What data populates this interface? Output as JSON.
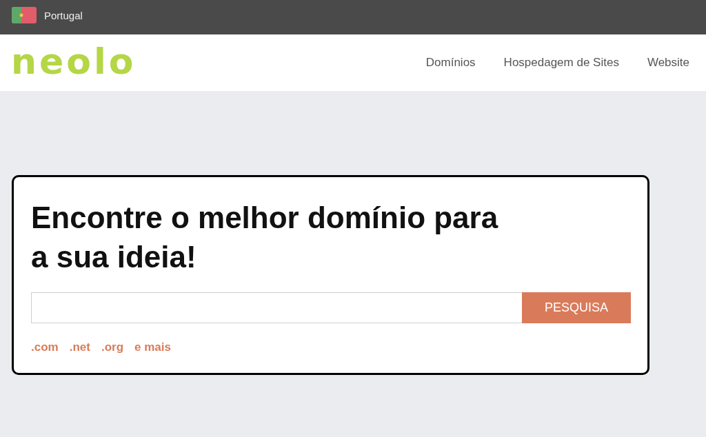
{
  "top_bar": {
    "country": "Portugal"
  },
  "header": {
    "logo": "neolo",
    "nav": [
      "Domínios",
      "Hospedagem de Sites",
      "Website"
    ]
  },
  "search_card": {
    "heading": "Encontre o melhor domínio para a sua ideia!",
    "button": "PESQUISA",
    "links": [
      ".com",
      ".net",
      ".org",
      "e mais"
    ]
  }
}
